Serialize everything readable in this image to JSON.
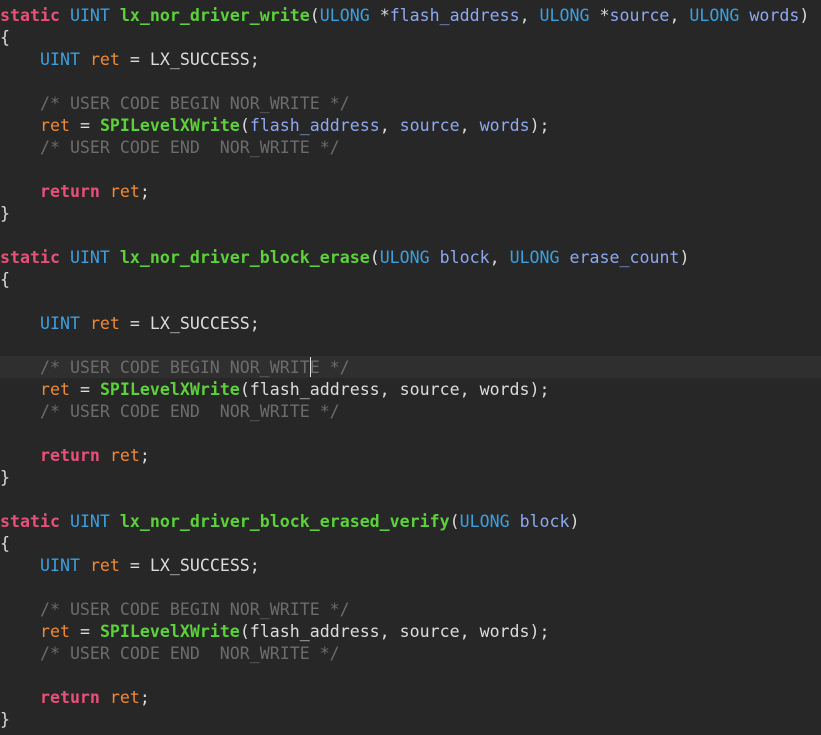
{
  "colors": {
    "background": "#272727",
    "current_line": "#2f2f2f",
    "keyword": "#e8507a",
    "type": "#3aa0e0",
    "function": "#5cd13a",
    "parameter": "#8fa8ef",
    "local_variable": "#f08a32",
    "plain": "#dcdcdc",
    "comment": "#6c6c6c"
  },
  "code_lines": [
    [
      {
        "t": "static",
        "k": "keyword"
      },
      {
        "t": " ",
        "k": "plain"
      },
      {
        "t": "UINT",
        "k": "type"
      },
      {
        "t": " ",
        "k": "plain"
      },
      {
        "t": "lx_nor_driver_write",
        "k": "function"
      },
      {
        "t": "(",
        "k": "plain"
      },
      {
        "t": "ULONG",
        "k": "type"
      },
      {
        "t": " *",
        "k": "plain"
      },
      {
        "t": "flash_address",
        "k": "parameter"
      },
      {
        "t": ", ",
        "k": "plain"
      },
      {
        "t": "ULONG",
        "k": "type"
      },
      {
        "t": " *",
        "k": "plain"
      },
      {
        "t": "source",
        "k": "parameter"
      },
      {
        "t": ", ",
        "k": "plain"
      },
      {
        "t": "ULONG",
        "k": "type"
      },
      {
        "t": " ",
        "k": "plain"
      },
      {
        "t": "words",
        "k": "parameter"
      },
      {
        "t": ")",
        "k": "plain"
      }
    ],
    [
      {
        "t": "{",
        "k": "plain"
      }
    ],
    [
      {
        "t": "    ",
        "k": "plain"
      },
      {
        "t": "UINT",
        "k": "type"
      },
      {
        "t": " ",
        "k": "plain"
      },
      {
        "t": "ret",
        "k": "local_variable"
      },
      {
        "t": " = LX_SUCCESS;",
        "k": "plain"
      }
    ],
    [],
    [
      {
        "t": "    ",
        "k": "plain"
      },
      {
        "t": "/* USER CODE BEGIN NOR_WRITE */",
        "k": "comment"
      }
    ],
    [
      {
        "t": "    ",
        "k": "plain"
      },
      {
        "t": "ret",
        "k": "local_variable"
      },
      {
        "t": " = ",
        "k": "plain"
      },
      {
        "t": "SPILevelXWrite",
        "k": "function"
      },
      {
        "t": "(",
        "k": "plain"
      },
      {
        "t": "flash_address",
        "k": "parameter"
      },
      {
        "t": ", ",
        "k": "plain"
      },
      {
        "t": "source",
        "k": "parameter"
      },
      {
        "t": ", ",
        "k": "plain"
      },
      {
        "t": "words",
        "k": "parameter"
      },
      {
        "t": ");",
        "k": "plain"
      }
    ],
    [
      {
        "t": "    ",
        "k": "plain"
      },
      {
        "t": "/* USER CODE END  NOR_WRITE */",
        "k": "comment"
      }
    ],
    [],
    [
      {
        "t": "    ",
        "k": "plain"
      },
      {
        "t": "return",
        "k": "keyword"
      },
      {
        "t": " ",
        "k": "plain"
      },
      {
        "t": "ret",
        "k": "local_variable"
      },
      {
        "t": ";",
        "k": "plain"
      }
    ],
    [
      {
        "t": "}",
        "k": "plain"
      }
    ],
    [],
    [
      {
        "t": "static",
        "k": "keyword"
      },
      {
        "t": " ",
        "k": "plain"
      },
      {
        "t": "UINT",
        "k": "type"
      },
      {
        "t": " ",
        "k": "plain"
      },
      {
        "t": "lx_nor_driver_block_erase",
        "k": "function"
      },
      {
        "t": "(",
        "k": "plain"
      },
      {
        "t": "ULONG",
        "k": "type"
      },
      {
        "t": " ",
        "k": "plain"
      },
      {
        "t": "block",
        "k": "parameter"
      },
      {
        "t": ", ",
        "k": "plain"
      },
      {
        "t": "ULONG",
        "k": "type"
      },
      {
        "t": " ",
        "k": "plain"
      },
      {
        "t": "erase_count",
        "k": "parameter"
      },
      {
        "t": ")",
        "k": "plain"
      }
    ],
    [
      {
        "t": "{",
        "k": "plain"
      }
    ],
    [],
    [
      {
        "t": "    ",
        "k": "plain"
      },
      {
        "t": "UINT",
        "k": "type"
      },
      {
        "t": " ",
        "k": "plain"
      },
      {
        "t": "ret",
        "k": "local_variable"
      },
      {
        "t": " = LX_SUCCESS;",
        "k": "plain"
      }
    ],
    [],
    [
      {
        "t": "    ",
        "k": "plain"
      },
      {
        "t": "/* USER CODE BEGIN NOR_WRITE */",
        "k": "comment"
      }
    ],
    [
      {
        "t": "    ",
        "k": "plain"
      },
      {
        "t": "ret",
        "k": "local_variable"
      },
      {
        "t": " = ",
        "k": "plain"
      },
      {
        "t": "SPILevelXWrite",
        "k": "function"
      },
      {
        "t": "(flash_address, source, words);",
        "k": "plain"
      }
    ],
    [
      {
        "t": "    ",
        "k": "plain"
      },
      {
        "t": "/* USER CODE END  NOR_WRITE */",
        "k": "comment"
      }
    ],
    [],
    [
      {
        "t": "    ",
        "k": "plain"
      },
      {
        "t": "return",
        "k": "keyword"
      },
      {
        "t": " ",
        "k": "plain"
      },
      {
        "t": "ret",
        "k": "local_variable"
      },
      {
        "t": ";",
        "k": "plain"
      }
    ],
    [
      {
        "t": "}",
        "k": "plain"
      }
    ],
    [],
    [
      {
        "t": "static",
        "k": "keyword"
      },
      {
        "t": " ",
        "k": "plain"
      },
      {
        "t": "UINT",
        "k": "type"
      },
      {
        "t": " ",
        "k": "plain"
      },
      {
        "t": "lx_nor_driver_block_erased_verify",
        "k": "function"
      },
      {
        "t": "(",
        "k": "plain"
      },
      {
        "t": "ULONG",
        "k": "type"
      },
      {
        "t": " ",
        "k": "plain"
      },
      {
        "t": "block",
        "k": "parameter"
      },
      {
        "t": ")",
        "k": "plain"
      }
    ],
    [
      {
        "t": "{",
        "k": "plain"
      }
    ],
    [
      {
        "t": "    ",
        "k": "plain"
      },
      {
        "t": "UINT",
        "k": "type"
      },
      {
        "t": " ",
        "k": "plain"
      },
      {
        "t": "ret",
        "k": "local_variable"
      },
      {
        "t": " = LX_SUCCESS;",
        "k": "plain"
      }
    ],
    [],
    [
      {
        "t": "    ",
        "k": "plain"
      },
      {
        "t": "/* USER CODE BEGIN NOR_WRITE */",
        "k": "comment"
      }
    ],
    [
      {
        "t": "    ",
        "k": "plain"
      },
      {
        "t": "ret",
        "k": "local_variable"
      },
      {
        "t": " = ",
        "k": "plain"
      },
      {
        "t": "SPILevelXWrite",
        "k": "function"
      },
      {
        "t": "(flash_address, source, words);",
        "k": "plain"
      }
    ],
    [
      {
        "t": "    ",
        "k": "plain"
      },
      {
        "t": "/* USER CODE END  NOR_WRITE */",
        "k": "comment"
      }
    ],
    [],
    [
      {
        "t": "    ",
        "k": "plain"
      },
      {
        "t": "return",
        "k": "keyword"
      },
      {
        "t": " ",
        "k": "plain"
      },
      {
        "t": "ret",
        "k": "local_variable"
      },
      {
        "t": ";",
        "k": "plain"
      }
    ],
    [
      {
        "t": "}",
        "k": "plain"
      }
    ]
  ]
}
